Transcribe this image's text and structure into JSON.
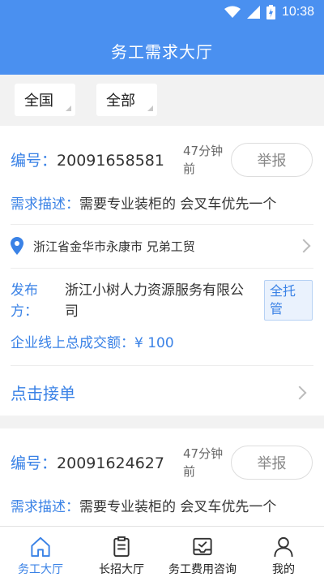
{
  "status_bar": {
    "time": "10:38"
  },
  "header": {
    "title": "务工需求大厅"
  },
  "filters": [
    {
      "label": "全国"
    },
    {
      "label": "全部"
    }
  ],
  "orders": [
    {
      "id_label": "编号：",
      "id": "20091658581",
      "posted": "47分钟前",
      "report_label": "举报",
      "desc_label": "需求描述：",
      "desc": "需要专业装柜的 会叉车优先一个",
      "location": "浙江省金华市永康市 兄弟工贸",
      "publisher_label": "发布方：",
      "publisher": "浙江小树人力资源服务有限公司",
      "badge": "全托管",
      "total_label": "企业线上总成交额：",
      "total": "¥ 100",
      "accept_label": "点击接单"
    },
    {
      "id_label": "编号：",
      "id": "20091624627",
      "posted": "47分钟前",
      "report_label": "举报",
      "desc_label": "需求描述：",
      "desc": "需要专业装柜的 会叉车优先一个"
    }
  ],
  "bottom_nav": [
    {
      "label": "务工大厅",
      "icon": "home-icon",
      "active": true
    },
    {
      "label": "长招大厅",
      "icon": "clipboard-icon",
      "active": false
    },
    {
      "label": "务工费用咨询",
      "icon": "inbox-check-icon",
      "active": false
    },
    {
      "label": "我的",
      "icon": "person-icon",
      "active": false
    }
  ],
  "colors": {
    "primary": "#4a90f0",
    "accent_text": "#3a82e6",
    "background": "#f2f2f2"
  }
}
